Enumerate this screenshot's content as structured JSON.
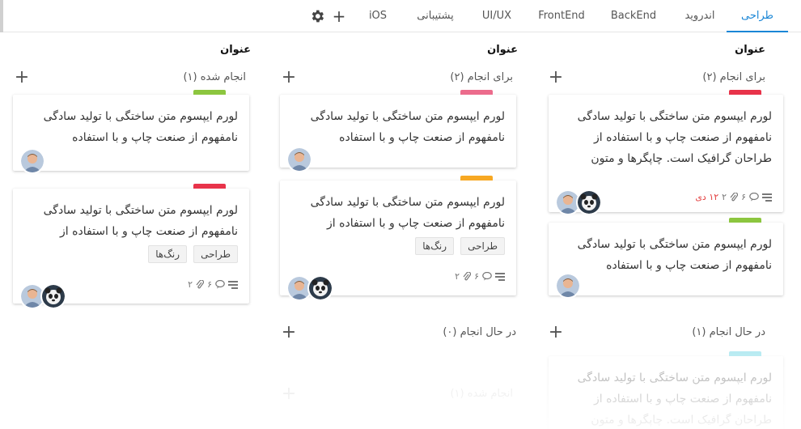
{
  "tabs": [
    {
      "label": "طراحی",
      "active": true
    },
    {
      "label": "اندروید",
      "active": false
    },
    {
      "label": "BackEnd",
      "active": false
    },
    {
      "label": "FrontEnd",
      "active": false
    },
    {
      "label": "UI/UX",
      "active": false
    },
    {
      "label": "پشتیبانی",
      "active": false
    },
    {
      "label": "iOS",
      "active": false
    }
  ],
  "toolbar": {
    "add_icon": "plus-icon",
    "settings_icon": "gear-icon"
  },
  "colors": {
    "accent": "#1a86d6",
    "tag_red": "#e8334a",
    "tag_green": "#8cc63f",
    "tag_pink": "#ec6c8c",
    "tag_orange": "#f7a823",
    "tag_cyan": "#5bd1e0",
    "due": "#e23b3b"
  },
  "columns": [
    {
      "title": "عنوان",
      "sections": [
        {
          "title": "برای انجام (۲)"
        },
        {
          "title": "در حال انجام (۱)"
        }
      ],
      "cards": [
        {
          "text": "لورم ایپسوم متن ساختگی با تولید سادگی نامفهوم از صنعت چاپ و با استفاده از طراحان گرافیک است. چاپگرها و متون",
          "due": "۱۲ دی",
          "comments": "۲",
          "attachments": "۶"
        },
        {
          "text": "لورم ایپسوم متن ساختگی با تولید سادگی نامفهوم از صنعت چاپ و با استفاده"
        },
        {
          "text": "لورم ایپسوم متن ساختگی با تولید سادگی نامفهوم از صنعت چاپ و با استفاده از طراحان گرافیک است. چاپگرها و متون"
        }
      ]
    },
    {
      "title": "عنوان",
      "sections": [
        {
          "title": "برای انجام (۲)"
        },
        {
          "title": "در حال انجام (۰)"
        },
        {
          "title": "انجام شده (۱)"
        }
      ],
      "cards": [
        {
          "text": "لورم ایپسوم متن ساختگی با تولید سادگی نامفهوم از صنعت چاپ و با استفاده"
        },
        {
          "text": "لورم ایپسوم متن ساختگی با تولید سادگی نامفهوم از صنعت چاپ و با استفاده از",
          "labels": [
            "طراحی",
            "رنگ‌ها"
          ],
          "comments": "۲",
          "attachments": "۶"
        }
      ]
    },
    {
      "title": "عنوان",
      "sections": [
        {
          "title": "انجام شده (۱)"
        }
      ],
      "cards": [
        {
          "text": "لورم ایپسوم متن ساختگی با تولید سادگی نامفهوم از صنعت چاپ و با استفاده"
        },
        {
          "text": "لورم ایپسوم متن ساختگی با تولید سادگی نامفهوم از صنعت چاپ و با استفاده از",
          "labels": [
            "طراحی",
            "رنگ‌ها"
          ],
          "comments": "۲",
          "attachments": "۶"
        }
      ]
    }
  ]
}
